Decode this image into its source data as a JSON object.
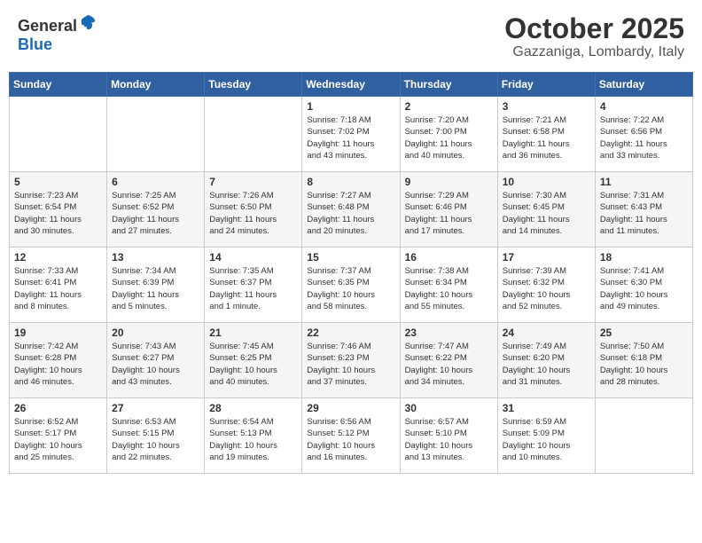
{
  "header": {
    "logo_general": "General",
    "logo_blue": "Blue",
    "month_title": "October 2025",
    "location": "Gazzaniga, Lombardy, Italy"
  },
  "days_of_week": [
    "Sunday",
    "Monday",
    "Tuesday",
    "Wednesday",
    "Thursday",
    "Friday",
    "Saturday"
  ],
  "weeks": [
    [
      {
        "day": "",
        "info": ""
      },
      {
        "day": "",
        "info": ""
      },
      {
        "day": "",
        "info": ""
      },
      {
        "day": "1",
        "info": "Sunrise: 7:18 AM\nSunset: 7:02 PM\nDaylight: 11 hours\nand 43 minutes."
      },
      {
        "day": "2",
        "info": "Sunrise: 7:20 AM\nSunset: 7:00 PM\nDaylight: 11 hours\nand 40 minutes."
      },
      {
        "day": "3",
        "info": "Sunrise: 7:21 AM\nSunset: 6:58 PM\nDaylight: 11 hours\nand 36 minutes."
      },
      {
        "day": "4",
        "info": "Sunrise: 7:22 AM\nSunset: 6:56 PM\nDaylight: 11 hours\nand 33 minutes."
      }
    ],
    [
      {
        "day": "5",
        "info": "Sunrise: 7:23 AM\nSunset: 6:54 PM\nDaylight: 11 hours\nand 30 minutes."
      },
      {
        "day": "6",
        "info": "Sunrise: 7:25 AM\nSunset: 6:52 PM\nDaylight: 11 hours\nand 27 minutes."
      },
      {
        "day": "7",
        "info": "Sunrise: 7:26 AM\nSunset: 6:50 PM\nDaylight: 11 hours\nand 24 minutes."
      },
      {
        "day": "8",
        "info": "Sunrise: 7:27 AM\nSunset: 6:48 PM\nDaylight: 11 hours\nand 20 minutes."
      },
      {
        "day": "9",
        "info": "Sunrise: 7:29 AM\nSunset: 6:46 PM\nDaylight: 11 hours\nand 17 minutes."
      },
      {
        "day": "10",
        "info": "Sunrise: 7:30 AM\nSunset: 6:45 PM\nDaylight: 11 hours\nand 14 minutes."
      },
      {
        "day": "11",
        "info": "Sunrise: 7:31 AM\nSunset: 6:43 PM\nDaylight: 11 hours\nand 11 minutes."
      }
    ],
    [
      {
        "day": "12",
        "info": "Sunrise: 7:33 AM\nSunset: 6:41 PM\nDaylight: 11 hours\nand 8 minutes."
      },
      {
        "day": "13",
        "info": "Sunrise: 7:34 AM\nSunset: 6:39 PM\nDaylight: 11 hours\nand 5 minutes."
      },
      {
        "day": "14",
        "info": "Sunrise: 7:35 AM\nSunset: 6:37 PM\nDaylight: 11 hours\nand 1 minute."
      },
      {
        "day": "15",
        "info": "Sunrise: 7:37 AM\nSunset: 6:35 PM\nDaylight: 10 hours\nand 58 minutes."
      },
      {
        "day": "16",
        "info": "Sunrise: 7:38 AM\nSunset: 6:34 PM\nDaylight: 10 hours\nand 55 minutes."
      },
      {
        "day": "17",
        "info": "Sunrise: 7:39 AM\nSunset: 6:32 PM\nDaylight: 10 hours\nand 52 minutes."
      },
      {
        "day": "18",
        "info": "Sunrise: 7:41 AM\nSunset: 6:30 PM\nDaylight: 10 hours\nand 49 minutes."
      }
    ],
    [
      {
        "day": "19",
        "info": "Sunrise: 7:42 AM\nSunset: 6:28 PM\nDaylight: 10 hours\nand 46 minutes."
      },
      {
        "day": "20",
        "info": "Sunrise: 7:43 AM\nSunset: 6:27 PM\nDaylight: 10 hours\nand 43 minutes."
      },
      {
        "day": "21",
        "info": "Sunrise: 7:45 AM\nSunset: 6:25 PM\nDaylight: 10 hours\nand 40 minutes."
      },
      {
        "day": "22",
        "info": "Sunrise: 7:46 AM\nSunset: 6:23 PM\nDaylight: 10 hours\nand 37 minutes."
      },
      {
        "day": "23",
        "info": "Sunrise: 7:47 AM\nSunset: 6:22 PM\nDaylight: 10 hours\nand 34 minutes."
      },
      {
        "day": "24",
        "info": "Sunrise: 7:49 AM\nSunset: 6:20 PM\nDaylight: 10 hours\nand 31 minutes."
      },
      {
        "day": "25",
        "info": "Sunrise: 7:50 AM\nSunset: 6:18 PM\nDaylight: 10 hours\nand 28 minutes."
      }
    ],
    [
      {
        "day": "26",
        "info": "Sunrise: 6:52 AM\nSunset: 5:17 PM\nDaylight: 10 hours\nand 25 minutes."
      },
      {
        "day": "27",
        "info": "Sunrise: 6:53 AM\nSunset: 5:15 PM\nDaylight: 10 hours\nand 22 minutes."
      },
      {
        "day": "28",
        "info": "Sunrise: 6:54 AM\nSunset: 5:13 PM\nDaylight: 10 hours\nand 19 minutes."
      },
      {
        "day": "29",
        "info": "Sunrise: 6:56 AM\nSunset: 5:12 PM\nDaylight: 10 hours\nand 16 minutes."
      },
      {
        "day": "30",
        "info": "Sunrise: 6:57 AM\nSunset: 5:10 PM\nDaylight: 10 hours\nand 13 minutes."
      },
      {
        "day": "31",
        "info": "Sunrise: 6:59 AM\nSunset: 5:09 PM\nDaylight: 10 hours\nand 10 minutes."
      },
      {
        "day": "",
        "info": ""
      }
    ]
  ]
}
